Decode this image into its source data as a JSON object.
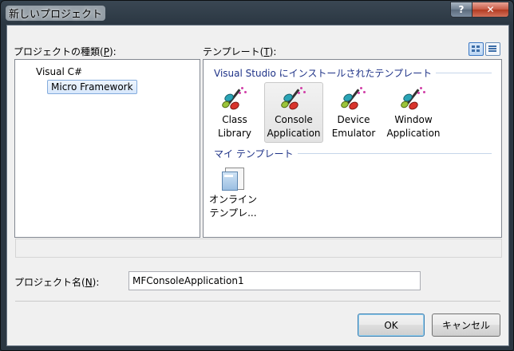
{
  "window": {
    "title": "新しいプロジェクト"
  },
  "caption": {
    "help": "?",
    "close": "✕"
  },
  "project_types": {
    "label_pre": "プロジェクトの種類(",
    "label_key": "P",
    "label_post": "):",
    "items": [
      "Visual C#",
      "Micro Framework"
    ]
  },
  "templates": {
    "label_pre": "テンプレート(",
    "label_key": "T",
    "label_post": "):",
    "installed_header": "Visual Studio にインストールされたテンプレート",
    "installed": [
      {
        "line1": "Class",
        "line2": "Library",
        "icon": "wizard-wand-icon"
      },
      {
        "line1": "Console",
        "line2": "Application",
        "icon": "wizard-wand-icon"
      },
      {
        "line1": "Device",
        "line2": "Emulator",
        "icon": "wizard-wand-icon"
      },
      {
        "line1": "Window",
        "line2": "Application",
        "icon": "wizard-wand-icon"
      }
    ],
    "selected_index": 1,
    "my_header": "マイ テンプレート",
    "my": [
      {
        "line1": "オンライン",
        "line2": "テンプレ...",
        "icon": "online-template-icon"
      }
    ]
  },
  "view_buttons": {
    "large": "large-icons-view-icon",
    "small": "small-icons-view-icon"
  },
  "name_field": {
    "label_pre": "プロジェクト名(",
    "label_key": "N",
    "label_post": "):",
    "value": "MFConsoleApplication1"
  },
  "buttons": {
    "ok": "OK",
    "cancel": "キャンセル"
  }
}
